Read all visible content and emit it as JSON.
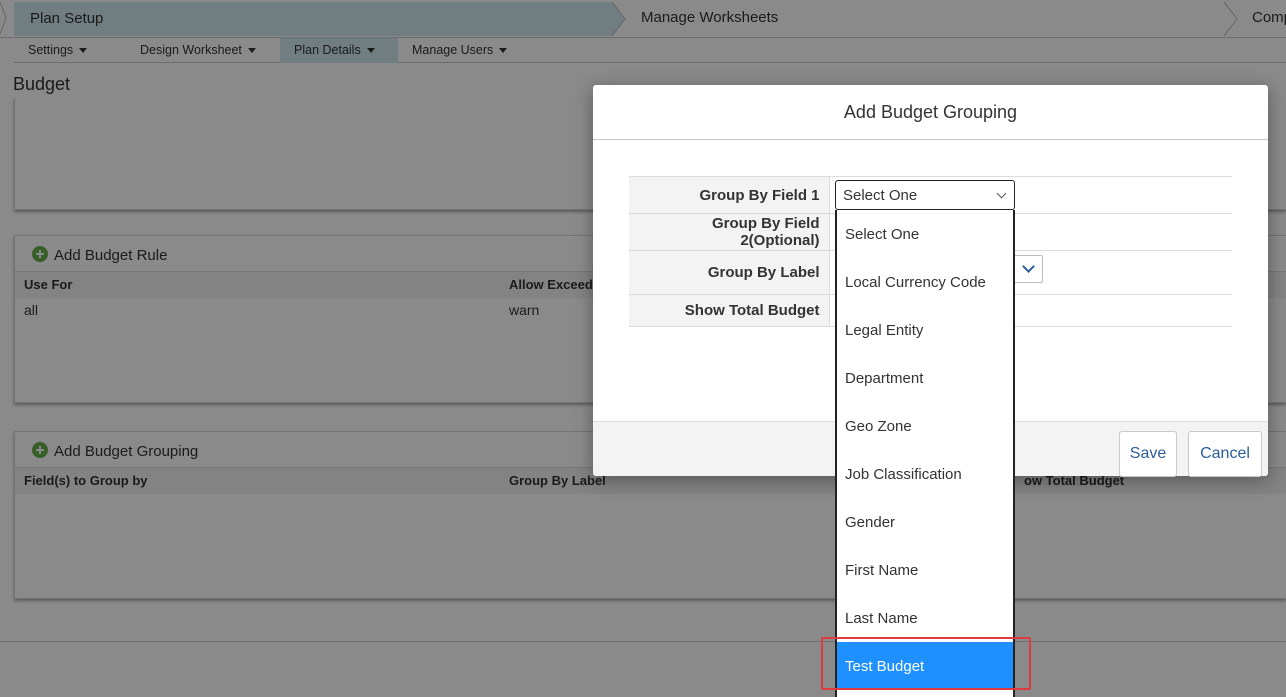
{
  "stepbar": {
    "steps": [
      "Plan Setup",
      "Manage Worksheets",
      "Comp"
    ]
  },
  "subnav": {
    "items": [
      "Settings",
      "Design Worksheet",
      "Plan Details",
      "Manage Users"
    ],
    "active": "Plan Details"
  },
  "page": {
    "title": "Budget"
  },
  "budget_rule": {
    "add_label": "Add Budget Rule",
    "columns": [
      "Use For",
      "Allow Exceed"
    ],
    "rows": [
      [
        "all",
        "warn"
      ]
    ]
  },
  "budget_grouping": {
    "add_label": "Add Budget Grouping",
    "columns": [
      "Field(s) to Group by",
      "Group By Label",
      "ow Total Budget"
    ]
  },
  "modal": {
    "title": "Add Budget Grouping",
    "fields": {
      "group_by_field_1": "Group By Field 1",
      "group_by_field_2": "Group By Field 2(Optional)",
      "group_by_label": "Group By Label",
      "show_total_budget": "Show Total Budget"
    },
    "select_value": "Select One",
    "save_label": "Save",
    "cancel_label": "Cancel"
  },
  "dropdown": {
    "options": [
      "Select One",
      "Local Currency Code",
      "Legal Entity",
      "Department",
      "Geo Zone",
      "Job Classification",
      "Gender",
      "First Name",
      "Last Name",
      "Test Budget"
    ],
    "highlighted": "Test Budget"
  },
  "colors": {
    "accent": "#cfe9ef",
    "link": "#2b5c9c",
    "selected": "#1e90ff",
    "highlight_border": "#e0393e",
    "add_icon": "#6ab04c"
  },
  "icons": [
    "plus-circle-icon",
    "chevron-down-icon",
    "caret-down-icon"
  ]
}
